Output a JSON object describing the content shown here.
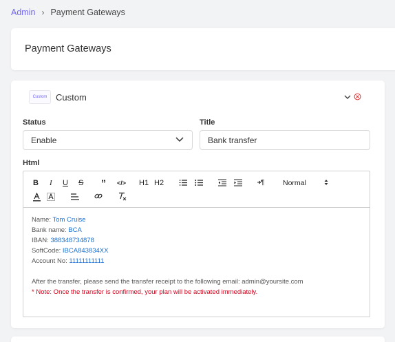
{
  "breadcrumb": {
    "root": "Admin",
    "separator": "›",
    "current": "Payment Gateways"
  },
  "page": {
    "title": "Payment Gateways"
  },
  "gateway": {
    "logo_text": "Custom",
    "name": "Custom",
    "status": {
      "label": "Status",
      "value": "Enable"
    },
    "title_field": {
      "label": "Title",
      "value": "Bank transfer"
    },
    "html_field": {
      "label": "Html"
    },
    "toolbar": {
      "bold": "B",
      "italic": "I",
      "underline": "U",
      "strike": "S",
      "blockquote": "”",
      "code": "</>",
      "h1": "H1",
      "h2": "H2",
      "direction": "¶",
      "size": "Normal"
    },
    "content": {
      "line1_label": "Name: ",
      "line1_value": "Tom Cruise",
      "line2_label": "Bank name: ",
      "line2_value": "BCA",
      "line3_label": "IBAN: ",
      "line3_value": "388348734878",
      "line4_label": "SoftCode: ",
      "line4_value": "IBCA843834XX",
      "line5_label": "Account No: ",
      "line5_value": "11111111111",
      "instruction": "After the transfer, please send the transfer receipt to the following email: admin@yoursite.com",
      "note": "* Note: Once the transfer is confirmed, your plan will be activated immediately."
    }
  },
  "colors": {
    "accent": "#7367f0",
    "link_blue": "#1a6fd0",
    "danger": "#d0021b"
  }
}
